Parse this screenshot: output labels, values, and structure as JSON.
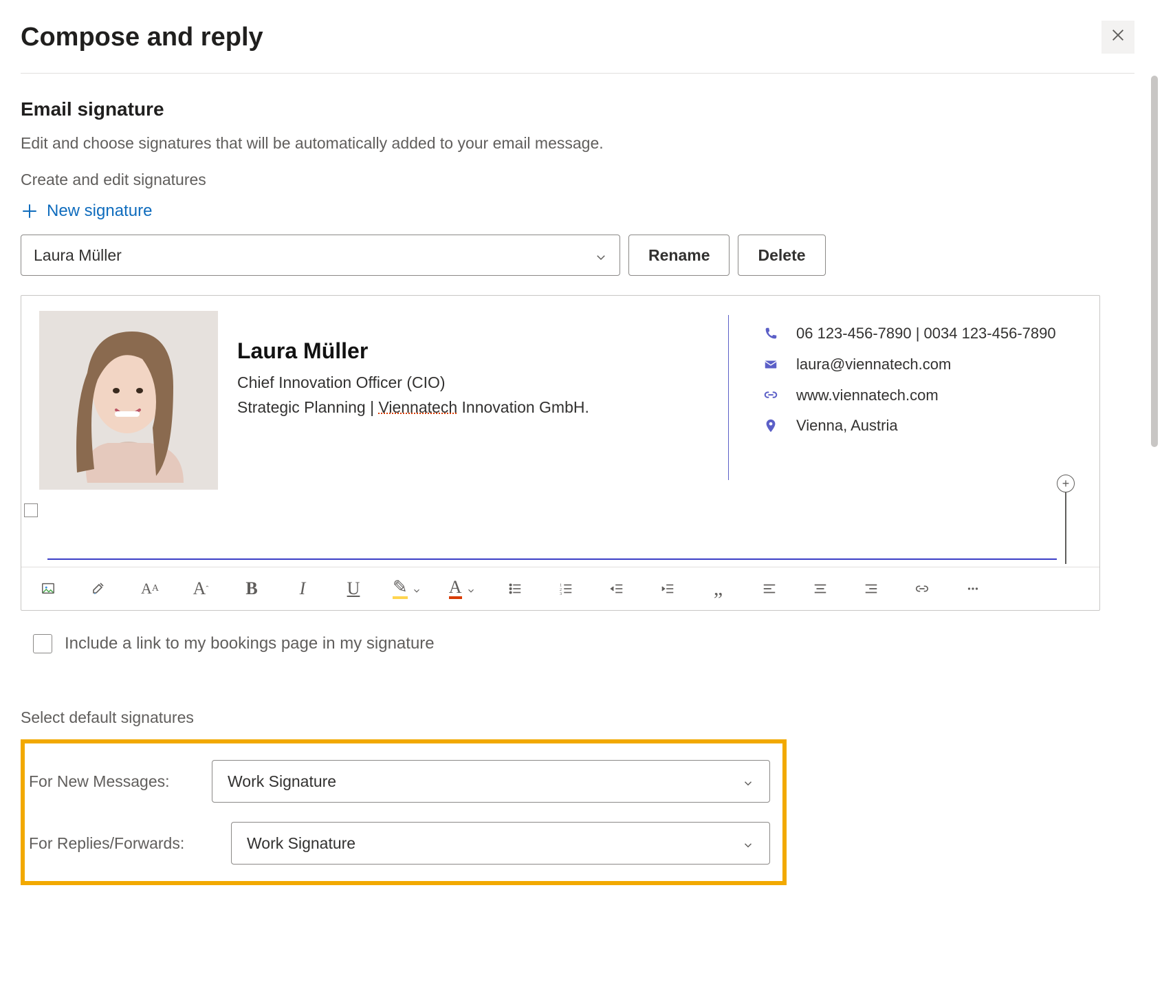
{
  "header": {
    "title": "Compose and reply"
  },
  "section": {
    "title": "Email signature",
    "description": "Edit and choose signatures that will be automatically added to your email message.",
    "create_label": "Create and edit signatures",
    "new_signature_label": "New signature",
    "selected_signature": "Laura Müller",
    "rename_label": "Rename",
    "delete_label": "Delete"
  },
  "signature": {
    "name": "Laura Müller",
    "title": "Chief Innovation Officer (CIO)",
    "dept_prefix": "Strategic Planning | ",
    "company_underlined": "Viennatech",
    "dept_suffix": " Innovation GmbH.",
    "phone": "06 123-456-7890 | 0034 123-456-7890",
    "email": "laura@viennatech.com",
    "web": "www.viennatech.com",
    "location": "Vienna, Austria"
  },
  "toolbar": {
    "bold": "B",
    "italic": "I",
    "underline": "U",
    "highlight_glyph": "✎",
    "font_color_glyph": "A",
    "quote_glyph": "„"
  },
  "bookings": {
    "label": "Include a link to my bookings page in my signature",
    "checked": false
  },
  "defaults": {
    "section_label": "Select default signatures",
    "new_label": "For New Messages:",
    "reply_label": "For Replies/Forwards:",
    "new_value": "Work Signature",
    "reply_value": "Work Signature"
  }
}
